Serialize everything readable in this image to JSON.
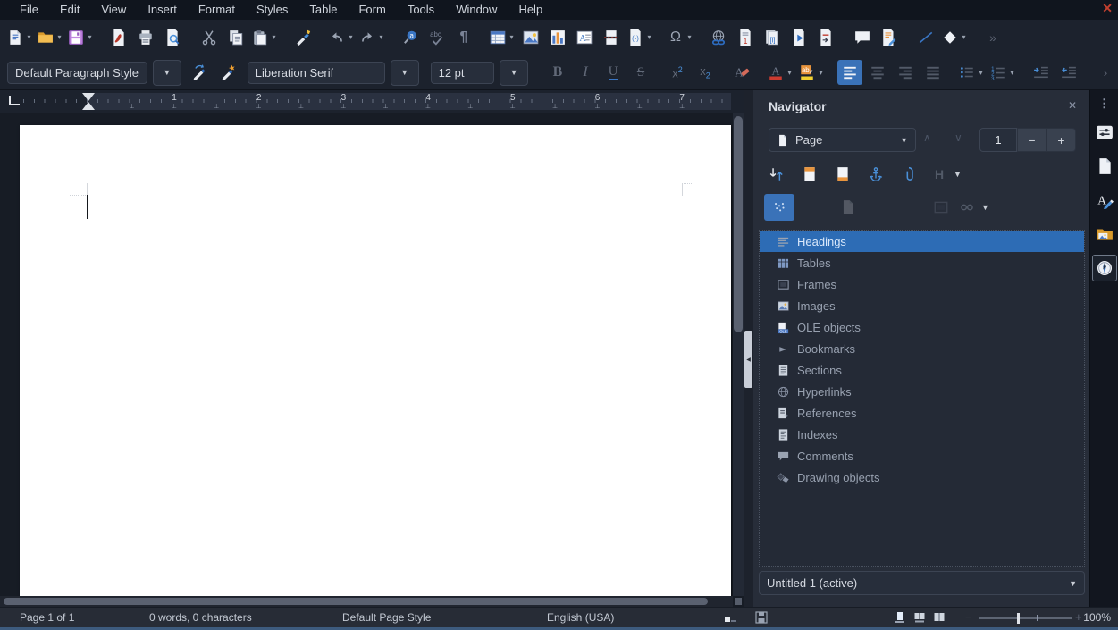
{
  "window": {
    "close_label": "✕"
  },
  "menubar": {
    "items": [
      "File",
      "Edit",
      "View",
      "Insert",
      "Format",
      "Styles",
      "Table",
      "Form",
      "Tools",
      "Window",
      "Help"
    ]
  },
  "toolbar_standard": {
    "items": [
      {
        "name": "new-document",
        "icon": "new-doc",
        "dropdown": true
      },
      {
        "name": "open",
        "icon": "folder",
        "dropdown": true
      },
      {
        "name": "save",
        "icon": "floppy",
        "dropdown": true,
        "sep": true
      },
      {
        "name": "export-pdf",
        "icon": "pdf"
      },
      {
        "name": "print",
        "icon": "printer"
      },
      {
        "name": "print-preview",
        "icon": "preview",
        "sep": true
      },
      {
        "name": "cut",
        "icon": "scissors"
      },
      {
        "name": "copy",
        "icon": "copy"
      },
      {
        "name": "paste",
        "icon": "paste",
        "dropdown": true,
        "sep": true
      },
      {
        "name": "clone-formatting",
        "icon": "clone",
        "sep": true
      },
      {
        "name": "undo",
        "icon": "undo",
        "dropdown": true
      },
      {
        "name": "redo",
        "icon": "redo",
        "dropdown": true,
        "sep": true
      },
      {
        "name": "find-and-replace",
        "icon": "find"
      },
      {
        "name": "spelling",
        "icon": "spelling"
      },
      {
        "name": "formatting-marks",
        "icon": "pilcrow",
        "sep": true
      },
      {
        "name": "insert-table",
        "icon": "table",
        "dropdown": true
      },
      {
        "name": "insert-image",
        "icon": "image"
      },
      {
        "name": "insert-chart",
        "icon": "chart"
      },
      {
        "name": "insert-text-box",
        "icon": "textbox"
      },
      {
        "name": "insert-page-break",
        "icon": "pagebreak"
      },
      {
        "name": "insert-field",
        "icon": "field",
        "dropdown": true,
        "sep": true
      },
      {
        "name": "insert-special-character",
        "icon": "omega",
        "dropdown": true,
        "sep": true
      },
      {
        "name": "insert-hyperlink",
        "icon": "hyperlink"
      },
      {
        "name": "insert-footnote",
        "icon": "footnote"
      },
      {
        "name": "insert-endnote",
        "icon": "endnote"
      },
      {
        "name": "insert-bookmark",
        "icon": "bookmark"
      },
      {
        "name": "insert-cross-reference",
        "icon": "crossref",
        "sep": true
      },
      {
        "name": "insert-comment",
        "icon": "comment"
      },
      {
        "name": "track-changes",
        "icon": "trackchanges",
        "sep": true
      },
      {
        "name": "insert-line",
        "icon": "line"
      },
      {
        "name": "basic-shapes",
        "icon": "shapes",
        "dropdown": true,
        "sep": true
      },
      {
        "name": "toolbar-overflow",
        "icon": "chevrons"
      }
    ]
  },
  "formatting": {
    "paragraph_style": "Default Paragraph Style",
    "font_name": "Liberation Serif",
    "font_size": "12 pt",
    "style_tools": [
      {
        "name": "update-style",
        "icon": "update-style"
      },
      {
        "name": "new-style",
        "icon": "new-style"
      }
    ],
    "buttons": [
      {
        "name": "bold",
        "icon": "bold",
        "gap": true
      },
      {
        "name": "italic",
        "icon": "italic"
      },
      {
        "name": "underline",
        "icon": "underline"
      },
      {
        "name": "strikethrough",
        "icon": "strikethrough"
      },
      {
        "name": "superscript",
        "icon": "superscript",
        "gap": true
      },
      {
        "name": "subscript",
        "icon": "subscript"
      },
      {
        "name": "clear-formatting",
        "icon": "clearfmt",
        "gap": true
      },
      {
        "name": "font-color",
        "icon": "fontcolor",
        "dropdown": true,
        "gap": true
      },
      {
        "name": "highlight-color",
        "icon": "highlight",
        "dropdown": true
      },
      {
        "name": "align-left",
        "icon": "alignleft",
        "active": true,
        "gap": true
      },
      {
        "name": "align-center",
        "icon": "aligncenter"
      },
      {
        "name": "align-right",
        "icon": "alignright"
      },
      {
        "name": "justify",
        "icon": "justify"
      },
      {
        "name": "unordered-list",
        "icon": "bullets",
        "dropdown": true,
        "gap": true
      },
      {
        "name": "ordered-list",
        "icon": "numbering",
        "dropdown": true
      },
      {
        "name": "increase-indent",
        "icon": "indentinc",
        "gap": true
      },
      {
        "name": "decrease-indent",
        "icon": "indentdec"
      },
      {
        "name": "formatting-overflow",
        "icon": "chevron1",
        "gap": true
      }
    ]
  },
  "ruler": {
    "numbers": [
      "1",
      "2",
      "3",
      "4",
      "5",
      "6",
      "7"
    ]
  },
  "navigator": {
    "title": "Navigator",
    "close_label": "✕",
    "page_selector": {
      "label": "Page",
      "value": "1",
      "minus": "−",
      "plus": "+",
      "prev": "∧",
      "next": "∨"
    },
    "tools_row1": [
      {
        "name": "toggle-master-view",
        "icon": "master"
      },
      {
        "name": "header",
        "icon": "header"
      },
      {
        "name": "footer",
        "icon": "footer"
      },
      {
        "name": "anchor-text",
        "icon": "anchor"
      },
      {
        "name": "set-reminder",
        "icon": "clip"
      },
      {
        "name": "show-outline-level",
        "icon": "hlevel",
        "dropdown": true
      }
    ],
    "tools_row2": [
      {
        "name": "content-navigation-view",
        "icon": "contentview",
        "active": true
      },
      {
        "name": "drag-mode",
        "icon": "dragmode",
        "dropdown": true
      }
    ],
    "content_list": [
      {
        "label": "Headings",
        "icon": "li-headings",
        "selected": true
      },
      {
        "label": "Tables",
        "icon": "li-tables"
      },
      {
        "label": "Frames",
        "icon": "li-frames"
      },
      {
        "label": "Images",
        "icon": "li-images"
      },
      {
        "label": "OLE objects",
        "icon": "li-ole"
      },
      {
        "label": "Bookmarks",
        "icon": "li-bookmarks"
      },
      {
        "label": "Sections",
        "icon": "li-sections"
      },
      {
        "label": "Hyperlinks",
        "icon": "li-hyperlinks"
      },
      {
        "label": "References",
        "icon": "li-references"
      },
      {
        "label": "Indexes",
        "icon": "li-indexes"
      },
      {
        "label": "Comments",
        "icon": "li-comments"
      },
      {
        "label": "Drawing objects",
        "icon": "li-drawing"
      }
    ],
    "document_selector": "Untitled 1 (active)"
  },
  "sidebar_tabs": [
    {
      "name": "sidebar-menu",
      "icon": "dots",
      "glyph": "⋮"
    },
    {
      "name": "tab-properties",
      "icon": "properties"
    },
    {
      "name": "tab-page",
      "icon": "pagetab"
    },
    {
      "name": "tab-styles",
      "icon": "stylestab"
    },
    {
      "name": "tab-gallery",
      "icon": "gallery"
    },
    {
      "name": "tab-navigator",
      "icon": "compass",
      "active": true
    }
  ],
  "statusbar": {
    "page": "Page 1 of 1",
    "words": "0 words, 0 characters",
    "page_style": "Default Page Style",
    "language": "English (USA)",
    "zoom_out": "−",
    "zoom_in": "+",
    "zoom": "100%"
  },
  "colors": {
    "accent_blue": "#3a72b8",
    "selection_blue": "#2d6cb5",
    "menubar_bg": "#10151e",
    "toolbar_bg": "#1c222d",
    "panel_bg": "#272d39",
    "page_bg": "#ffffff"
  }
}
